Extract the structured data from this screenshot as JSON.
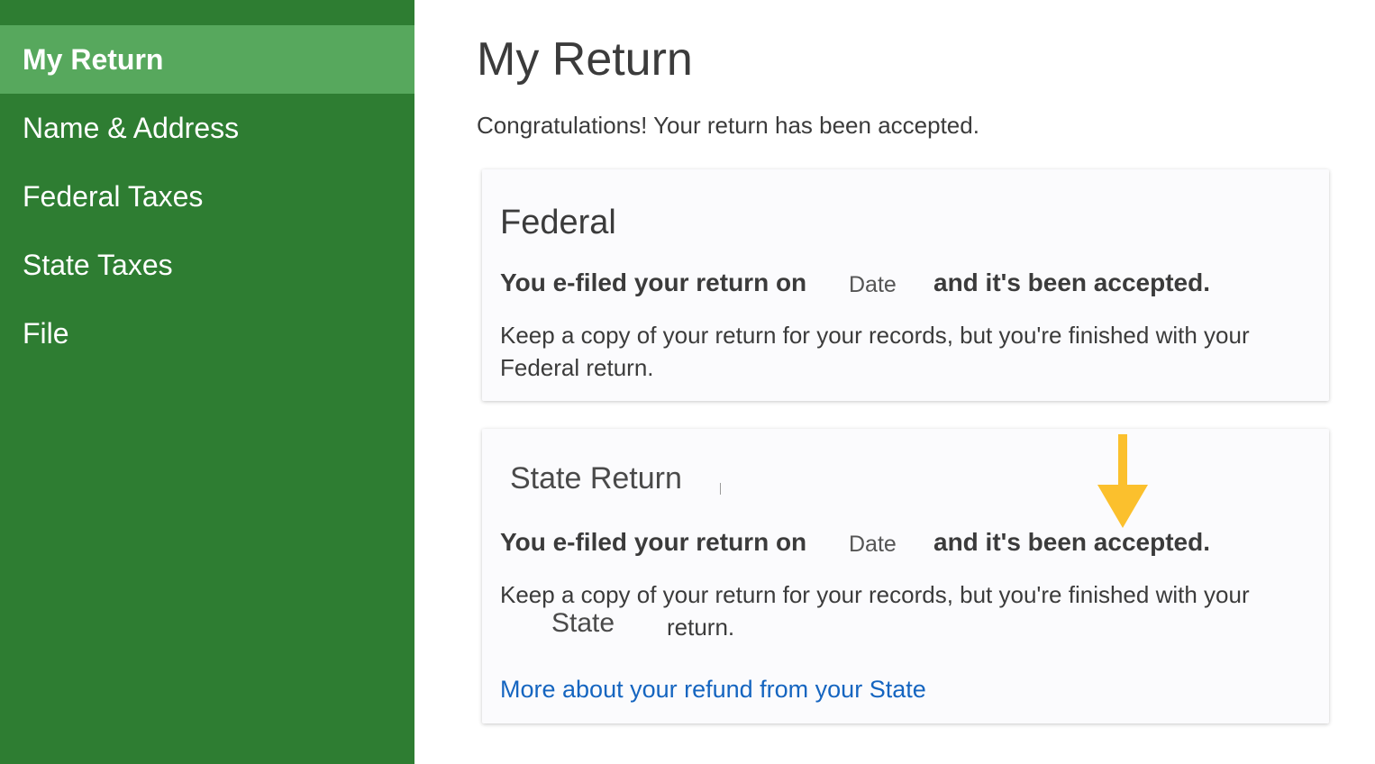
{
  "sidebar": {
    "items": [
      {
        "label": "My Return",
        "active": true
      },
      {
        "label": "Name & Address",
        "active": false
      },
      {
        "label": "Federal Taxes",
        "active": false
      },
      {
        "label": "State Taxes",
        "active": false
      },
      {
        "label": "File",
        "active": false
      }
    ]
  },
  "main": {
    "title": "My Return",
    "intro": "Congratulations! Your return has been accepted.",
    "federal": {
      "title": "Federal",
      "filed_prefix": "You e-filed your return on",
      "date_placeholder": "Date",
      "filed_suffix": "and it's been accepted.",
      "keep_line1": "Keep a copy of your return for your records, but you're finished with your",
      "keep_line2": "Federal return."
    },
    "state": {
      "title": "State Return",
      "filed_prefix": "You e-filed your return on",
      "date_placeholder": "Date",
      "filed_suffix": "and it's been accepted.",
      "keep_line1": "Keep a copy of your return for your records, but you're finished with your",
      "state_word": "State",
      "return_word": "return.",
      "link_label": "More about your refund from your State"
    }
  },
  "colors": {
    "sidebar_bg": "#2e7d32",
    "sidebar_active": "#57a85d",
    "link": "#1565c0",
    "arrow": "#fbc02d"
  },
  "icons": {
    "annotation": "arrow-down-icon"
  }
}
